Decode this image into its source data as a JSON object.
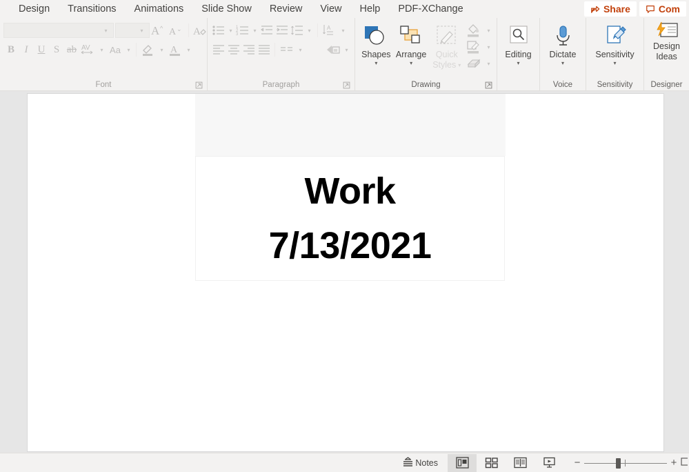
{
  "ribbon": {
    "tabs": [
      {
        "label": "Design"
      },
      {
        "label": "Transitions"
      },
      {
        "label": "Animations"
      },
      {
        "label": "Slide Show"
      },
      {
        "label": "Review"
      },
      {
        "label": "View"
      },
      {
        "label": "Help"
      },
      {
        "label": "PDF-XChange"
      }
    ],
    "share_label": "Share",
    "comments_label": "Com",
    "accent_color": "#c2410c",
    "groups": {
      "font": {
        "label": "Font",
        "font_name_value": "",
        "font_size_value": "",
        "buttons": [
          "increase-font-size",
          "decrease-font-size",
          "clear-formatting",
          "bold",
          "italic",
          "underline",
          "shadow",
          "strikethrough",
          "character-spacing",
          "change-case",
          "text-highlight-color",
          "font-color"
        ]
      },
      "paragraph": {
        "label": "Paragraph",
        "buttons": [
          "bullets",
          "numbering",
          "decrease-indent",
          "increase-indent",
          "line-spacing",
          "align-left",
          "align-center",
          "align-right",
          "justify",
          "columns",
          "text-direction",
          "align-text",
          "convert-to-smartart"
        ]
      },
      "drawing": {
        "label": "Drawing",
        "shapes_label": "Shapes",
        "arrange_label": "Arrange",
        "quick_styles_label_line1": "Quick",
        "quick_styles_label_line2": "Styles",
        "shape_fill": "shape-fill",
        "shape_outline": "shape-outline",
        "shape_effects": "shape-effects"
      },
      "editing": {
        "label": "Editing"
      },
      "voice": {
        "label": "Voice",
        "dictate_label": "Dictate"
      },
      "sensitivity": {
        "label": "Sensitivity",
        "button_label": "Sensitivity"
      },
      "designer": {
        "label": "Designer",
        "button_label_line1": "Design",
        "button_label_line2": "Ideas"
      }
    }
  },
  "slide": {
    "title": "Work",
    "subtitle": "7/13/2021"
  },
  "status": {
    "notes_label": "Notes",
    "views": [
      {
        "name": "normal-view",
        "active": true
      },
      {
        "name": "slide-sorter-view",
        "active": false
      },
      {
        "name": "reading-view",
        "active": false
      },
      {
        "name": "slide-show-view",
        "active": false
      }
    ],
    "zoom_out_label": "−",
    "zoom_in_label": "+"
  }
}
